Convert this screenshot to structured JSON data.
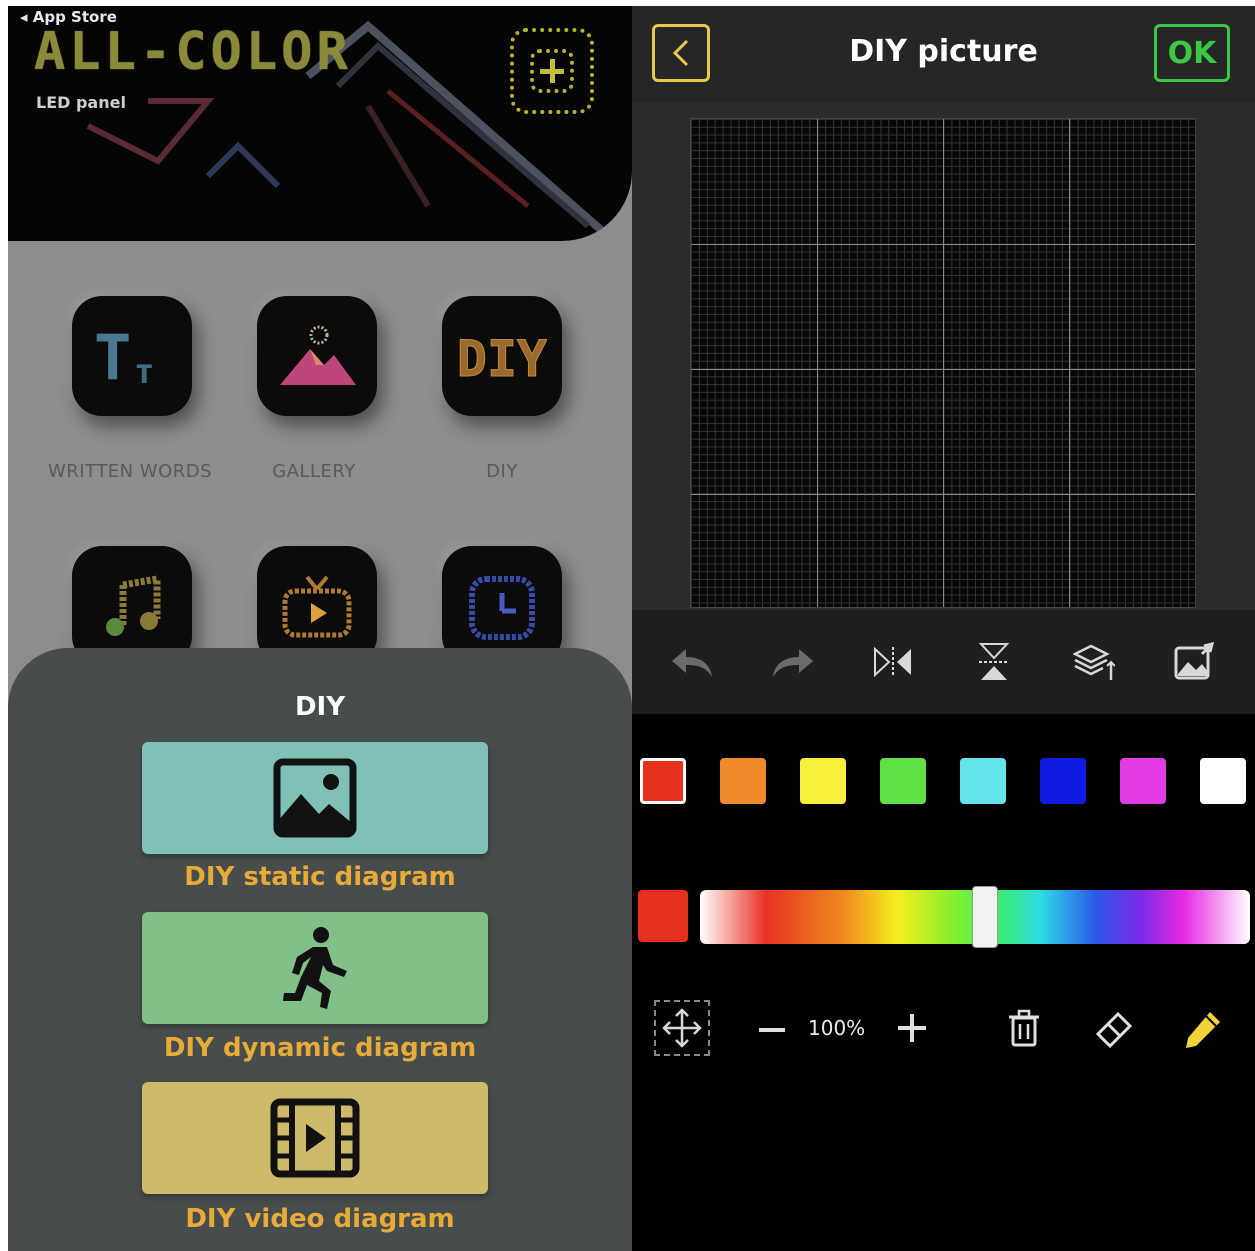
{
  "status_bar": {
    "back_label": "◂ App Store"
  },
  "home": {
    "logo_text": "ALL-COLOR",
    "logo_subtitle": "LED panel",
    "tiles": [
      {
        "label": "WRITTEN WORDS",
        "icon": "text-size-icon"
      },
      {
        "label": "GALLERY",
        "icon": "gallery-icon"
      },
      {
        "label": "DIY",
        "icon": "diy-icon"
      },
      {
        "label": "",
        "icon": "music-note-icon"
      },
      {
        "label": "",
        "icon": "tv-play-icon"
      },
      {
        "label": "",
        "icon": "clock-icon"
      }
    ],
    "diy_icon_text": "DIY",
    "text_icon_glyph": "Tт"
  },
  "diy_sheet": {
    "title": "DIY",
    "options": [
      {
        "label": "DIY static diagram",
        "icon": "image-icon",
        "color": "#7fc1b7"
      },
      {
        "label": "DIY dynamic diagram",
        "icon": "running-person-icon",
        "color": "#82c08a"
      },
      {
        "label": "DIY video diagram",
        "icon": "film-play-icon",
        "color": "#cdbb6b"
      }
    ]
  },
  "editor": {
    "title": "DIY picture",
    "ok_label": "OK",
    "tools": [
      "undo-icon",
      "redo-icon",
      "flip-horizontal-icon",
      "flip-vertical-icon",
      "layers-icon",
      "import-image-icon"
    ],
    "palette": [
      "#e8301f",
      "#f08a2a",
      "#f6ef3b",
      "#5fe044",
      "#62e4ea",
      "#0f1be0",
      "#e33be6",
      "#ffffff"
    ],
    "selected_color": "#e8301f",
    "zoom": "100%",
    "bottom_tools": [
      "move-icon",
      "zoom-out-icon",
      "zoom-in-icon",
      "trash-icon",
      "eraser-icon",
      "pencil-icon"
    ],
    "accent_ok": "#3ac944",
    "accent_back": "#e8c84a"
  }
}
